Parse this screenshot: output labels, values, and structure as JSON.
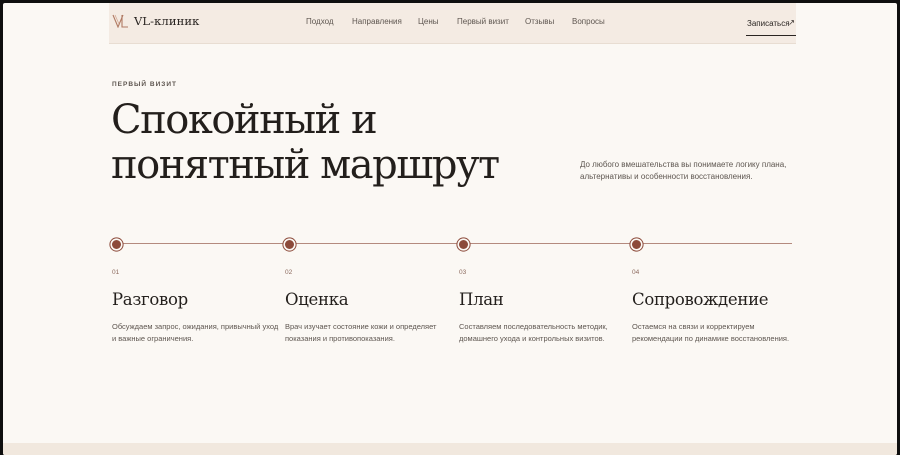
{
  "brand": {
    "name": "VL-клиник",
    "logo_mark": "VL-monogram-icon"
  },
  "nav": {
    "items": [
      "Подход",
      "Направления",
      "Цены",
      "Первый визит",
      "Отзывы",
      "Вопросы"
    ]
  },
  "cta": {
    "label": "Записаться",
    "arrow": "↗"
  },
  "hero": {
    "eyebrow": "ПЕРВЫЙ ВИЗИТ",
    "title": "Спокойный и понятный маршрут",
    "lead": "До любого вмешательства вы понимаете логику плана, альтернативы и особенности восстановления."
  },
  "steps": [
    {
      "num": "01",
      "title": "Разговор",
      "text": "Обсуждаем запрос, ожидания, привычный уход и важные ограничения."
    },
    {
      "num": "02",
      "title": "Оценка",
      "text": "Врач изучает состояние кожи и определяет показания и противопоказания."
    },
    {
      "num": "03",
      "title": "План",
      "text": "Составляем последовательность методик, домашнего ухода и контрольных визитов."
    },
    {
      "num": "04",
      "title": "Сопровождение",
      "text": "Остаемся на связи и корректируем рекомендации по динамике восстановления."
    }
  ],
  "colors": {
    "background": "#fbf8f4",
    "header": "#f4ebe3",
    "accent": "#8c4a3a",
    "text": "#231f1c",
    "muted": "#5e5650"
  }
}
